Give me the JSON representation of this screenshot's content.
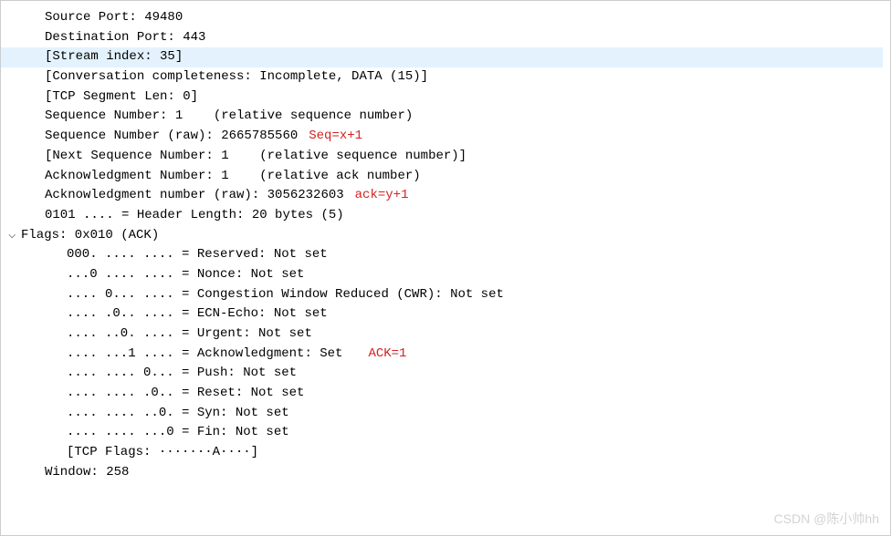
{
  "tcp": {
    "source_port": "Source Port: 49480",
    "dest_port": "Destination Port: 443",
    "stream_index": "[Stream index: 35]",
    "conv_complete": "[Conversation completeness: Incomplete, DATA (15)]",
    "seg_len": "[TCP Segment Len: 0]",
    "seq_num": "Sequence Number: 1    (relative sequence number)",
    "seq_num_raw": "Sequence Number (raw): 2665785560",
    "next_seq": "[Next Sequence Number: 1    (relative sequence number)]",
    "ack_num": "Acknowledgment Number: 1    (relative ack number)",
    "ack_num_raw": "Acknowledgment number (raw): 3056232603",
    "header_len": "0101 .... = Header Length: 20 bytes (5)",
    "flags_header": "Flags: 0x010 (ACK)",
    "flags": {
      "reserved": "000. .... .... = Reserved: Not set",
      "nonce": "...0 .... .... = Nonce: Not set",
      "cwr": ".... 0... .... = Congestion Window Reduced (CWR): Not set",
      "ecn": ".... .0.. .... = ECN-Echo: Not set",
      "urgent": ".... ..0. .... = Urgent: Not set",
      "ack": ".... ...1 .... = Acknowledgment: Set",
      "push": ".... .... 0... = Push: Not set",
      "reset": ".... .... .0.. = Reset: Not set",
      "syn": ".... .... ..0. = Syn: Not set",
      "fin": ".... .... ...0 = Fin: Not set",
      "summary": "[TCP Flags: ·······A····]"
    },
    "window": "Window: 258"
  },
  "annotations": {
    "seq": "Seq=x+1",
    "ack": "ack=y+1",
    "ackflag": "ACK=1"
  },
  "expander_glyph": "⌵",
  "watermark": "CSDN @陈小帅hh"
}
